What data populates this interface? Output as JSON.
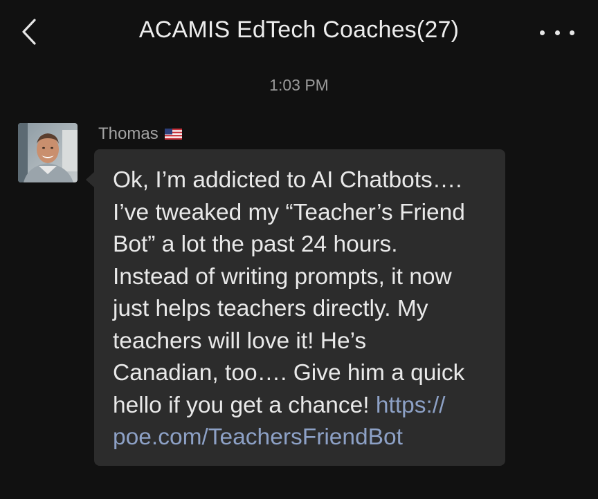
{
  "header": {
    "title": "ACAMIS EdTech Coaches(27)",
    "back_icon": "chevron-left-icon",
    "more_icon": "more-dots-icon"
  },
  "timestamp": "1:03 PM",
  "message": {
    "sender": "Thomas",
    "sender_flag": "us-flag-icon",
    "text": "Ok, I’m addicted to AI Chatbots….\nI’ve tweaked my “Teacher’s Friend\nBot” a lot the past 24 hours.\nInstead of writing prompts, it now\njust helps teachers directly. My\nteachers will love it! He’s\nCanadian, too…. Give him a quick\nhello if you get a chance! ",
    "link_line1": "https://",
    "link_line2": "poe.com/TeachersFriendBot"
  },
  "colors": {
    "background": "#111111",
    "bubble": "#2c2c2c",
    "link": "#8da1c6",
    "muted_text": "#9a9a9a"
  }
}
